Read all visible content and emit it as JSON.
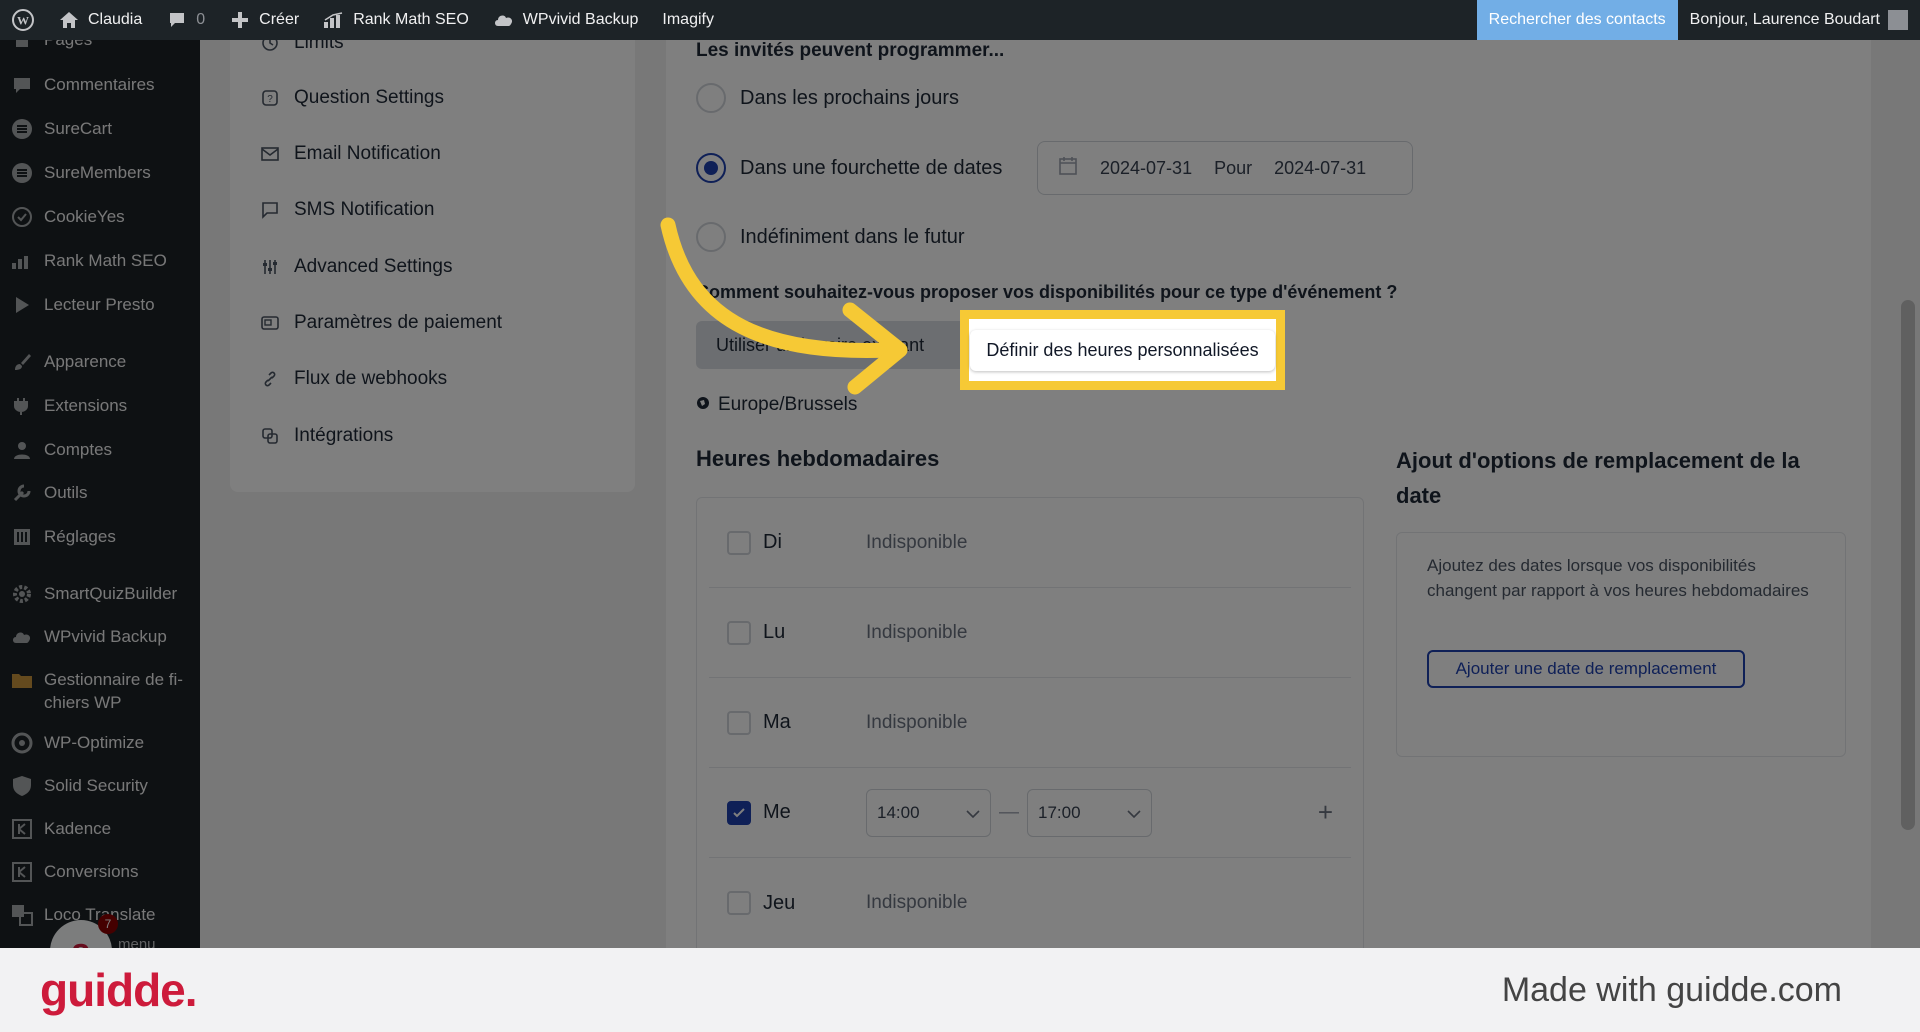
{
  "admin_bar": {
    "site_name": "Claudia",
    "comments_count": "0",
    "new_label": "Créer",
    "rank_math": "Rank Math SEO",
    "wpvivid": "WPvivid Backup",
    "imagify": "Imagify",
    "search_contacts": "Rechercher des contacts",
    "greeting": "Bonjour, Laurence Boudart"
  },
  "sidebar": {
    "items": [
      {
        "label": "Pages",
        "icon": "pages-icon"
      },
      {
        "label": "Commentaires",
        "icon": "comment-icon"
      },
      {
        "label": "SureCart",
        "icon": "surecart-icon"
      },
      {
        "label": "SureMembers",
        "icon": "suremembers-icon"
      },
      {
        "label": "CookieYes",
        "icon": "cookie-icon"
      },
      {
        "label": "Rank Math SEO",
        "icon": "chart-icon"
      },
      {
        "label": "Lecteur Presto",
        "icon": "play-icon"
      },
      {
        "label": "Apparence",
        "icon": "brush-icon"
      },
      {
        "label": "Extensions",
        "icon": "plug-icon"
      },
      {
        "label": "Comptes",
        "icon": "user-icon"
      },
      {
        "label": "Outils",
        "icon": "wrench-icon"
      },
      {
        "label": "Réglages",
        "icon": "sliders-icon"
      },
      {
        "label": "SmartQuizBuilder",
        "icon": "gear-icon"
      },
      {
        "label": "WPvivid Backup",
        "icon": "cloud-icon"
      },
      {
        "label": "Gestionnaire de fi-chiers WP",
        "icon": "folder-icon"
      },
      {
        "label": "WP-Optimize",
        "icon": "optimize-icon"
      },
      {
        "label": "Solid Security",
        "icon": "shield-icon"
      },
      {
        "label": "Kadence",
        "icon": "kadence-icon"
      },
      {
        "label": "Conversions",
        "icon": "conversions-icon"
      },
      {
        "label": "Loco Translate",
        "icon": "translate-icon"
      }
    ],
    "last_item_partial": "menu",
    "notif_badge": "7"
  },
  "settings_nav": {
    "items": [
      {
        "label": "Limits",
        "icon": "clock-icon"
      },
      {
        "label": "Question Settings",
        "icon": "question-icon"
      },
      {
        "label": "Email Notification",
        "icon": "mail-icon"
      },
      {
        "label": "SMS Notification",
        "icon": "sms-icon"
      },
      {
        "label": "Advanced Settings",
        "icon": "sliders-icon"
      },
      {
        "label": "Paramètres de paiement",
        "icon": "payment-icon"
      },
      {
        "label": "Flux de webhooks",
        "icon": "link-icon"
      },
      {
        "label": "Intégrations",
        "icon": "integrations-icon"
      }
    ]
  },
  "scheduling": {
    "heading": "Les invités peuvent programmer...",
    "options": [
      {
        "label": "Dans les prochains jours",
        "checked": false
      },
      {
        "label": "Dans une fourchette de dates",
        "checked": true
      },
      {
        "label": "Indéfiniment dans le futur",
        "checked": false
      }
    ],
    "date_from": "2024-07-31",
    "date_separator": "Pour",
    "date_to": "2024-07-31"
  },
  "availability": {
    "question": "Comment souhaitez-vous proposer vos disponibilités pour ce type d'événement ?",
    "existing_button": "Utiliser un horaire existant",
    "custom_button": "Définir des heures personnalisées",
    "timezone": "Europe/Brussels"
  },
  "weekly": {
    "heading": "Heures hebdomadaires",
    "days": [
      {
        "name": "Di",
        "checked": false,
        "status": "Indisponible"
      },
      {
        "name": "Lu",
        "checked": false,
        "status": "Indisponible"
      },
      {
        "name": "Ma",
        "checked": false,
        "status": "Indisponible"
      },
      {
        "name": "Me",
        "checked": true,
        "start": "14:00",
        "end": "17:00"
      },
      {
        "name": "Jeu",
        "checked": false,
        "status": "Indisponible"
      }
    ],
    "add_symbol": "+",
    "dash": "—"
  },
  "overrides": {
    "heading": "Ajout d'options de remplacement de la date",
    "description": "Ajoutez des dates lorsque vos disponibilités changent par rapport à vos heures hebdomadaires",
    "button": "Ajouter une date de remplacement"
  },
  "footer": {
    "logo": "guidde.",
    "made_with": "Made with guidde.com"
  },
  "colors": {
    "accent": "#1e40af",
    "highlight": "#f6c935",
    "brand": "#cd1b3b"
  }
}
